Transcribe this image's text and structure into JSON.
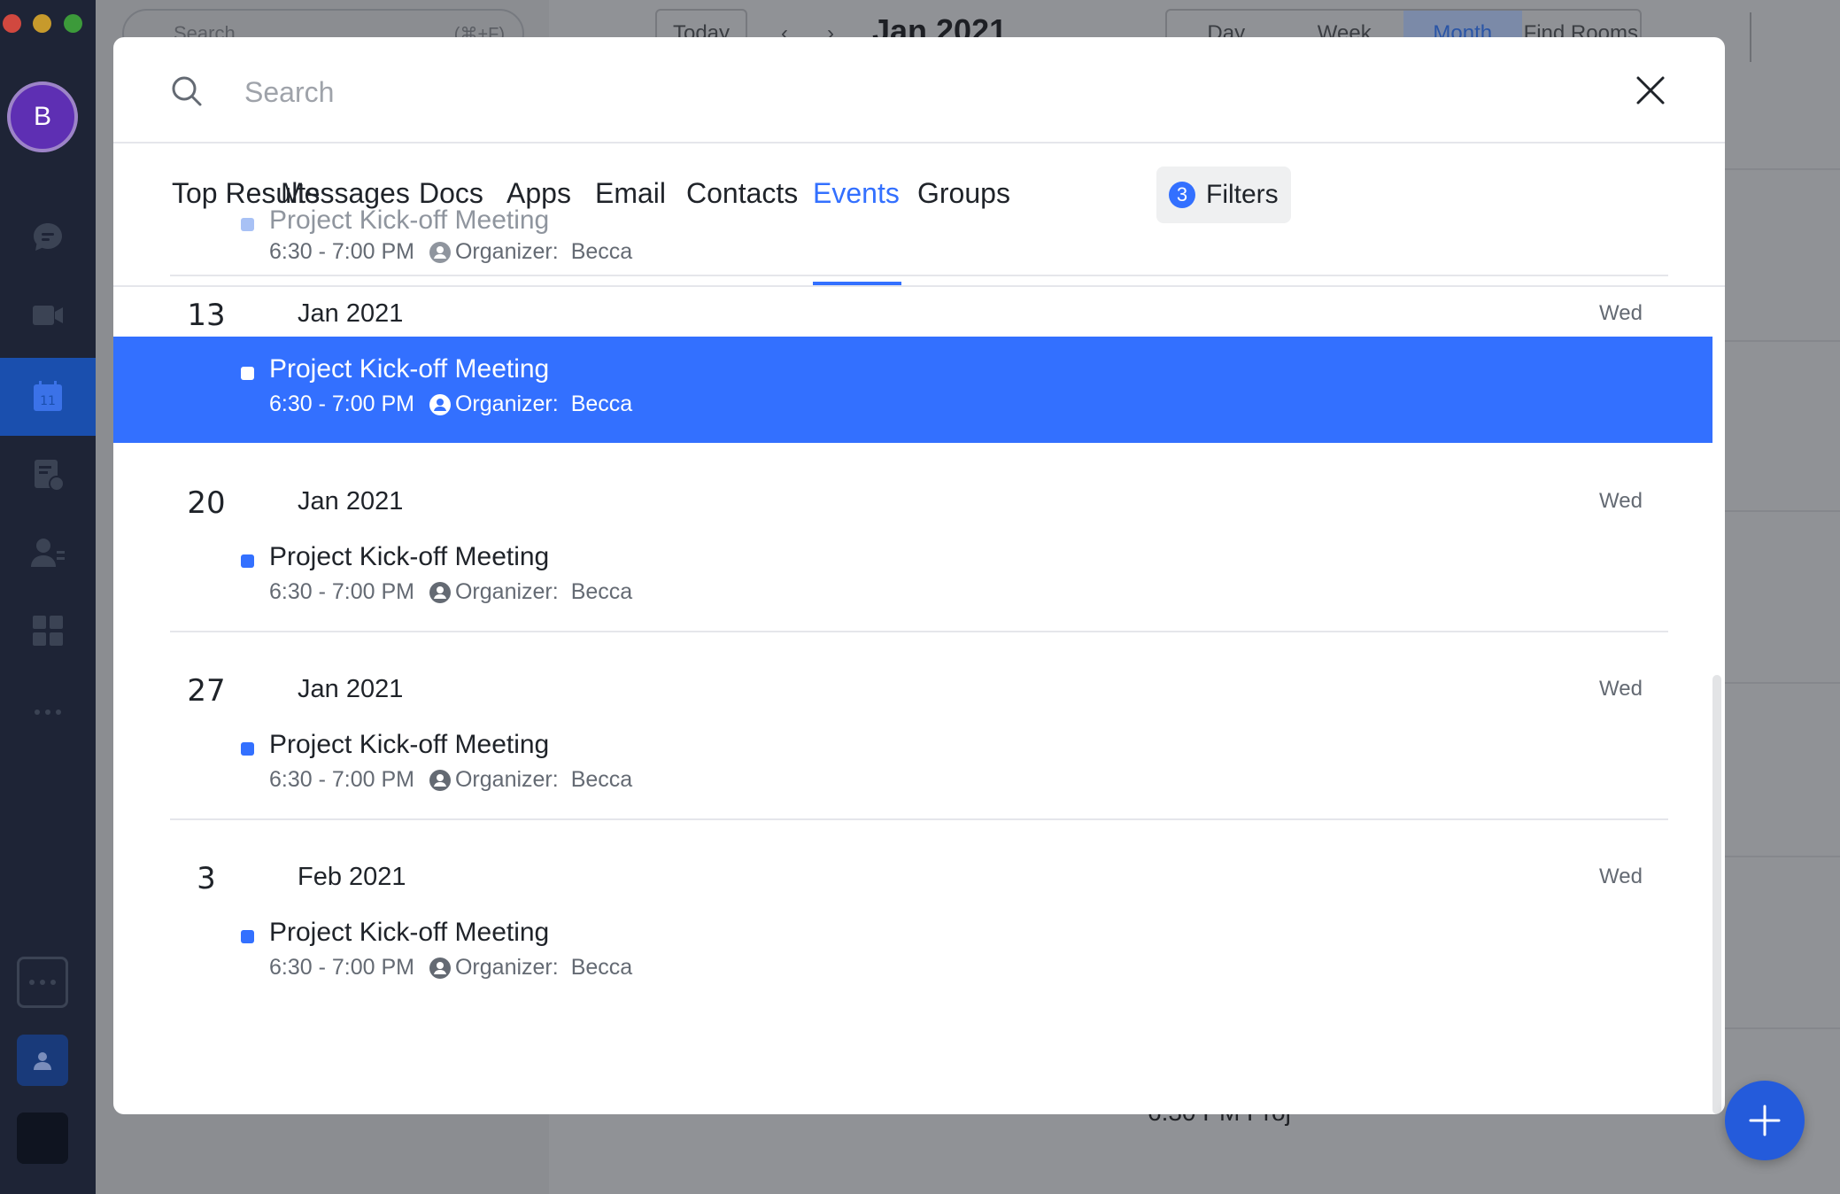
{
  "sidebar": {
    "avatar_initial": "B",
    "nav_icons": [
      "messenger-icon",
      "video-meeting-icon",
      "calendar-icon",
      "docs-icon",
      "contacts-icon",
      "workplace-icon",
      "more-icon"
    ],
    "calendar_day": "11"
  },
  "background": {
    "search_placeholder": "Search",
    "search_shortcut": "(⌘+F)",
    "today_label": "Today",
    "month_title": "Jan 2021",
    "views": [
      "Day",
      "Week",
      "Month",
      "Find Rooms"
    ],
    "active_view": "Month",
    "partial_event_text": "6:30 PM Proj"
  },
  "search": {
    "placeholder": "Search",
    "value": ""
  },
  "tabs": {
    "items": [
      "Top Results",
      "Messages",
      "Docs",
      "Apps",
      "Email",
      "Contacts",
      "Events",
      "Groups"
    ],
    "active": "Events"
  },
  "filters": {
    "count": "3",
    "label": "Filters"
  },
  "results": {
    "partial_event": {
      "title": "Project Kick-off Meeting",
      "time": "6:30 - 7:00 PM",
      "organizer_label": "Organizer:",
      "organizer": "Becca"
    },
    "groups": [
      {
        "day": "13",
        "month": "Jan 2021",
        "weekday": "Wed",
        "event": {
          "title": "Project Kick-off Meeting",
          "time": "6:30 - 7:00 PM",
          "organizer_label": "Organizer:",
          "organizer": "Becca"
        }
      },
      {
        "day": "20",
        "month": "Jan 2021",
        "weekday": "Wed",
        "event": {
          "title": "Project Kick-off Meeting",
          "time": "6:30 - 7:00 PM",
          "organizer_label": "Organizer:",
          "organizer": "Becca"
        }
      },
      {
        "day": "27",
        "month": "Jan 2021",
        "weekday": "Wed",
        "event": {
          "title": "Project Kick-off Meeting",
          "time": "6:30 - 7:00 PM",
          "organizer_label": "Organizer:",
          "organizer": "Becca"
        }
      },
      {
        "day": "3",
        "month": "Feb 2021",
        "weekday": "Wed",
        "event": {
          "title": "Project Kick-off Meeting",
          "time": "6:30 - 7:00 PM",
          "organizer_label": "Organizer:",
          "organizer": "Becca"
        }
      }
    ]
  },
  "colors": {
    "accent": "#3370ff",
    "sidebar": "#1e2436",
    "selected_row": "#3370ff"
  }
}
